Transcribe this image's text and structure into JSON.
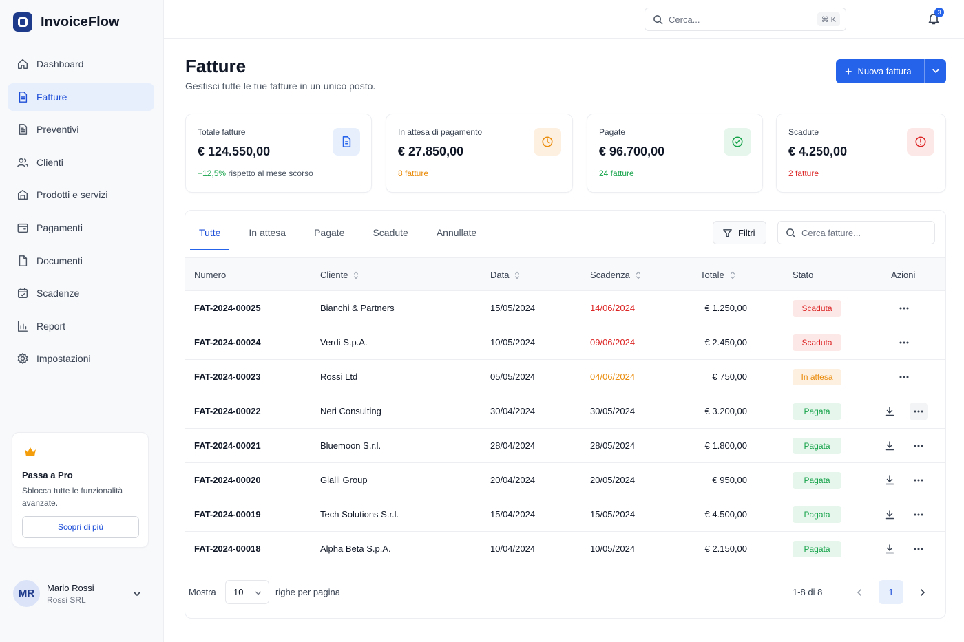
{
  "app": {
    "name": "InvoiceFlow"
  },
  "sidebar": {
    "items": [
      {
        "label": "Dashboard",
        "icon": "home-icon",
        "active": false
      },
      {
        "label": "Fatture",
        "icon": "document-icon",
        "active": true
      },
      {
        "label": "Preventivi",
        "icon": "file-text-icon",
        "active": false
      },
      {
        "label": "Clienti",
        "icon": "users-icon",
        "active": false
      },
      {
        "label": "Prodotti e servizi",
        "icon": "box-icon",
        "active": false
      },
      {
        "label": "Pagamenti",
        "icon": "wallet-icon",
        "active": false
      },
      {
        "label": "Documenti",
        "icon": "file-icon",
        "active": false
      },
      {
        "label": "Scadenze",
        "icon": "calendar-icon",
        "active": false
      },
      {
        "label": "Report",
        "icon": "chart-icon",
        "active": false
      },
      {
        "label": "Impostazioni",
        "icon": "gear-icon",
        "active": false
      }
    ],
    "promo": {
      "title": "Passa a Pro",
      "text": "Sblocca tutte le funzionalità avanzate.",
      "button": "Scopri di più"
    },
    "user": {
      "initials": "MR",
      "name": "Mario Rossi",
      "company": "Rossi SRL"
    }
  },
  "topbar": {
    "search_placeholder": "Cerca...",
    "shortcut": "⌘ K",
    "notifications": "3"
  },
  "page": {
    "title": "Fatture",
    "subtitle": "Gestisci tutte le tue fatture in un unico posto.",
    "new_button": "Nuova fattura"
  },
  "cards": [
    {
      "title": "Totale fatture",
      "value": "€ 124.550,00",
      "foot_highlight": "+12,5%",
      "foot": " rispetto al mese scorso",
      "icon": "document-icon",
      "color": "#2563eb",
      "bg": "#e8effc",
      "foot_color": "#16a34a"
    },
    {
      "title": "In attesa di pagamento",
      "value": "€ 27.850,00",
      "foot_highlight": "8 fatture",
      "foot": "",
      "icon": "clock-icon",
      "color": "#ea8c0c",
      "bg": "#fdf0e0",
      "foot_color": "#ea8c0c"
    },
    {
      "title": "Pagate",
      "value": "€ 96.700,00",
      "foot_highlight": "24 fatture",
      "foot": "",
      "icon": "check-circle-icon",
      "color": "#16a34a",
      "bg": "#e6f6ec",
      "foot_color": "#16a34a"
    },
    {
      "title": "Scadute",
      "value": "€ 4.250,00",
      "foot_highlight": "2 fatture",
      "foot": "",
      "icon": "alert-circle-icon",
      "color": "#dc2626",
      "bg": "#fde8e8",
      "foot_color": "#dc2626"
    }
  ],
  "tabs": [
    "Tutte",
    "In attesa",
    "Pagate",
    "Scadute",
    "Annullate"
  ],
  "filters": {
    "button": "Filtri",
    "search_placeholder": "Cerca fatture..."
  },
  "table": {
    "headers": [
      "Numero",
      "Cliente",
      "Data",
      "Scadenza",
      "Totale",
      "Stato",
      "Azioni"
    ],
    "rows": [
      {
        "numero": "FAT-2024-00025",
        "cliente": "Bianchi & Partners",
        "data": "15/05/2024",
        "scadenza": "14/06/2024",
        "totale": "€ 1.250,00",
        "stato": "Scaduta",
        "download": false
      },
      {
        "numero": "FAT-2024-00024",
        "cliente": "Verdi S.p.A.",
        "data": "10/05/2024",
        "scadenza": "09/06/2024",
        "totale": "€ 2.450,00",
        "stato": "Scaduta",
        "download": false
      },
      {
        "numero": "FAT-2024-00023",
        "cliente": "Rossi Ltd",
        "data": "05/05/2024",
        "scadenza": "04/06/2024",
        "totale": "€ 750,00",
        "stato": "In attesa",
        "download": false
      },
      {
        "numero": "FAT-2024-00022",
        "cliente": "Neri Consulting",
        "data": "30/04/2024",
        "scadenza": "30/05/2024",
        "totale": "€ 3.200,00",
        "stato": "Pagata",
        "download": true
      },
      {
        "numero": "FAT-2024-00021",
        "cliente": "Bluemoon S.r.l.",
        "data": "28/04/2024",
        "scadenza": "28/05/2024",
        "totale": "€ 1.800,00",
        "stato": "Pagata",
        "download": true
      },
      {
        "numero": "FAT-2024-00020",
        "cliente": "Gialli Group",
        "data": "20/04/2024",
        "scadenza": "20/05/2024",
        "totale": "€ 950,00",
        "stato": "Pagata",
        "download": true
      },
      {
        "numero": "FAT-2024-00019",
        "cliente": "Tech Solutions S.r.l.",
        "data": "15/04/2024",
        "scadenza": "15/05/2024",
        "totale": "€ 4.500,00",
        "stato": "Pagata",
        "download": true
      },
      {
        "numero": "FAT-2024-00018",
        "cliente": "Alpha Beta S.p.A.",
        "data": "10/04/2024",
        "scadenza": "10/05/2024",
        "totale": "€ 2.150,00",
        "stato": "Pagata",
        "download": true
      }
    ]
  },
  "status_styles": {
    "Scaduta": {
      "color": "#dc2626",
      "bg": "#fde8e8",
      "due_color": "#dc2626"
    },
    "In attesa": {
      "color": "#ea8c0c",
      "bg": "#fdf0e0",
      "due_color": "#ea8c0c"
    },
    "Pagata": {
      "color": "#16a34a",
      "bg": "#e6f6ec",
      "due_color": "#111827"
    }
  },
  "pagination": {
    "show_label": "Mostra",
    "per_page": "10",
    "per_page_label": "righe per pagina",
    "range": "1-8 di 8",
    "current_page": "1"
  }
}
